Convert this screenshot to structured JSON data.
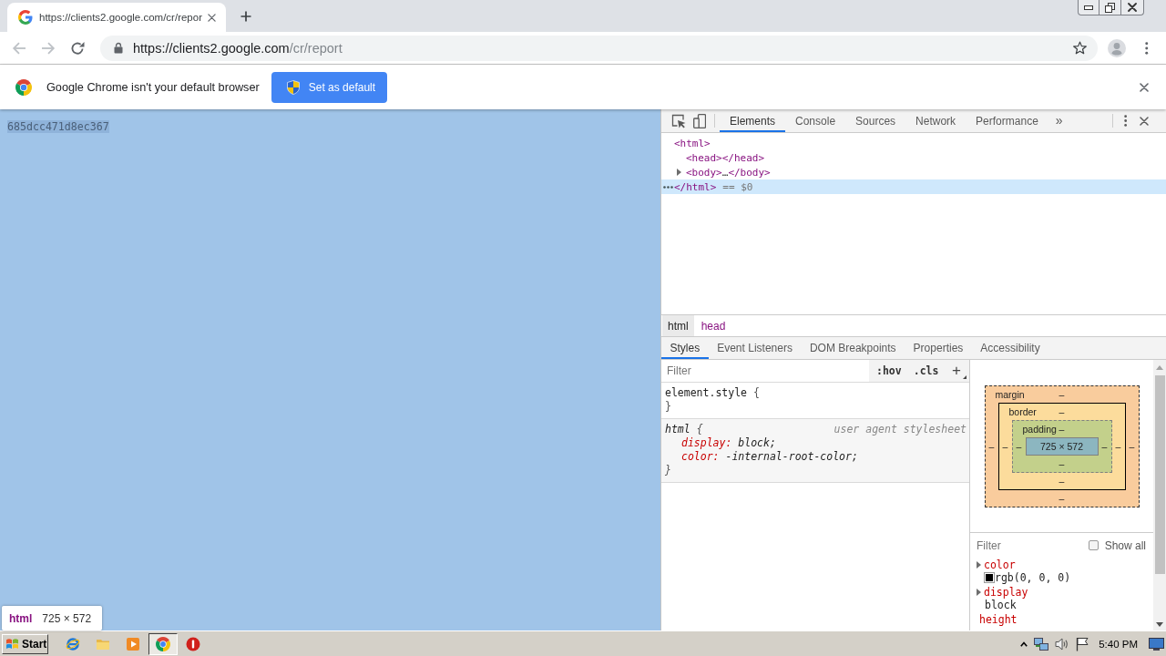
{
  "browser_tabs": [
    {
      "title": "https://clients2.google.com/cr/repor",
      "selected": true
    }
  ],
  "navigation": [
    {
      "kind": "back",
      "disabled": true
    },
    {
      "kind": "forward",
      "disabled": true
    },
    {
      "kind": "reload",
      "disabled": false
    }
  ],
  "address_bar": {
    "host": "https://clients2.google.com",
    "path": "/cr/report"
  },
  "infobar": {
    "message": "Google Chrome isn't your default browser",
    "button": "Set as default"
  },
  "page": {
    "text": "685dcc471d8ec367"
  },
  "element_tooltip": {
    "tag": "html",
    "size": "725 × 572"
  },
  "devtools": {
    "tabs": [
      {
        "label": "Elements",
        "selected": true
      },
      {
        "label": "Console",
        "selected": false
      },
      {
        "label": "Sources",
        "selected": false
      },
      {
        "label": "Network",
        "selected": false
      },
      {
        "label": "Performance",
        "selected": false
      }
    ],
    "more_tabs": "»",
    "dom_tree": [
      {
        "open": "<html>",
        "close": "</html>",
        "selected": true,
        "marker": "== $0",
        "children": [
          {
            "open": "<head>",
            "close": "</head>",
            "selected": false
          },
          {
            "open": "<body>",
            "collapsed_text": "…",
            "close": "</body>",
            "expanded": false,
            "selected": false
          }
        ]
      }
    ],
    "breadcrumbs": [
      {
        "label": "html",
        "selected": true
      },
      {
        "label": "head",
        "selected": false
      }
    ],
    "sidebar_tabs": [
      {
        "label": "Styles",
        "selected": true
      },
      {
        "label": "Event Listeners",
        "selected": false
      },
      {
        "label": "DOM Breakpoints",
        "selected": false
      },
      {
        "label": "Properties",
        "selected": false
      },
      {
        "label": "Accessibility",
        "selected": false
      }
    ],
    "styles": {
      "filter_placeholder": "Filter",
      "hov": ":hov",
      "cls": ".cls",
      "add": "+",
      "rules": [
        {
          "kind": "inline",
          "selector": "element.style",
          "open": "{",
          "close": "}"
        },
        {
          "kind": "user_agent",
          "selector": "html",
          "open": "{",
          "source": "user agent stylesheet",
          "declarations": [
            {
              "property": "display:",
              "value": "block;"
            },
            {
              "property": "color:",
              "value": "-internal-root-color;"
            }
          ],
          "close": "}"
        }
      ]
    },
    "box_model": {
      "layer": {
        "kind": "margin",
        "label": "margin",
        "top": "–",
        "left": "–",
        "inner": {
          "kind": "border",
          "label": "border",
          "top": "–",
          "left": "–",
          "inner": {
            "kind": "padding",
            "label": "padding",
            "top": "–",
            "left": "–",
            "content": "725 × 572",
            "right": "–",
            "bottom": "–"
          },
          "right": "–",
          "bottom": "–"
        },
        "right": "–",
        "bottom": "–"
      }
    },
    "computed": {
      "filter_placeholder": "Filter",
      "show_all": {
        "label": "Show all",
        "checked": false
      },
      "properties": [
        {
          "name": "color",
          "value": "rgb(0, 0, 0)",
          "color": "#000000",
          "expanded": false
        },
        {
          "name": "display",
          "value": "block",
          "expanded": false
        },
        {
          "name": "height"
        }
      ]
    }
  },
  "taskbar": {
    "start": "Start",
    "apps": [
      {
        "kind": "ie",
        "selected": false
      },
      {
        "kind": "folder",
        "selected": false
      },
      {
        "kind": "media",
        "selected": false
      },
      {
        "kind": "chrome",
        "selected": true
      },
      {
        "kind": "stop",
        "selected": false
      }
    ],
    "clock": "5:40 PM"
  }
}
